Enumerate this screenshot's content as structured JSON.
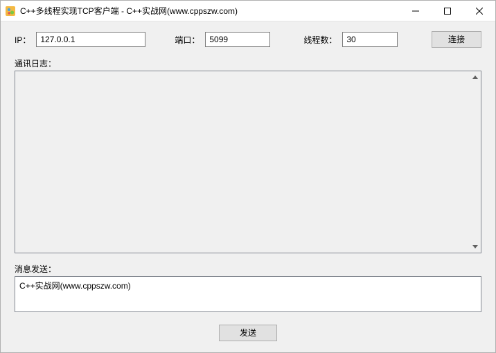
{
  "window": {
    "title": "C++多线程实现TCP客户端 - C++实战网(www.cppszw.com)"
  },
  "form": {
    "ip_label": "IP：",
    "ip_value": "127.0.0.1",
    "port_label": "端口：",
    "port_value": "5099",
    "threads_label": "线程数：",
    "threads_value": "30",
    "connect_label": "连接"
  },
  "log": {
    "section_label": "通讯日志：",
    "content": ""
  },
  "message": {
    "section_label": "消息发送：",
    "content": "C++实战网(www.cppszw.com)"
  },
  "send": {
    "label": "发送"
  }
}
